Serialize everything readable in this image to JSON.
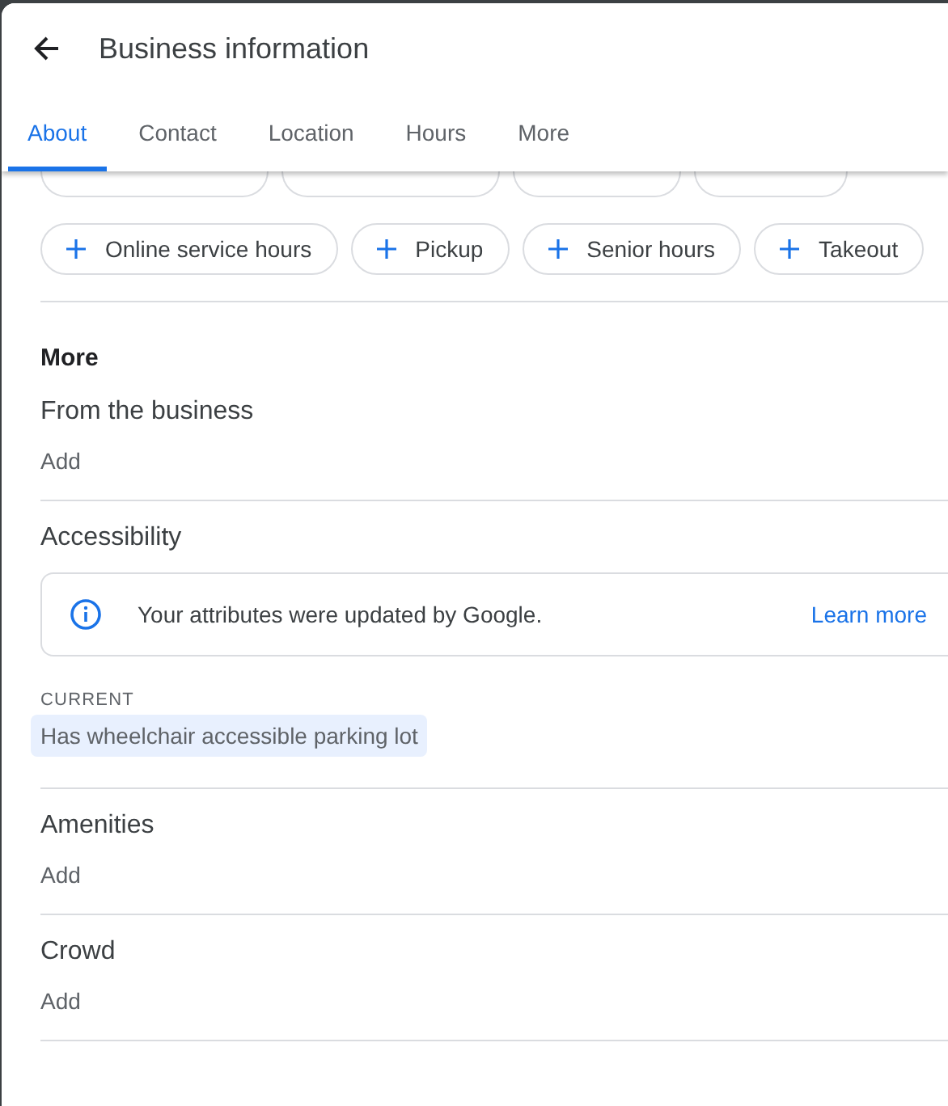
{
  "header": {
    "title": "Business information"
  },
  "tabs": [
    {
      "label": "About",
      "selected": true
    },
    {
      "label": "Contact",
      "selected": false
    },
    {
      "label": "Location",
      "selected": false
    },
    {
      "label": "Hours",
      "selected": false
    },
    {
      "label": "More",
      "selected": false
    }
  ],
  "clipped_chips": [
    {
      "kind": "chip"
    },
    {
      "kind": "chip"
    },
    {
      "kind": "chip"
    },
    {
      "kind": "chip"
    }
  ],
  "chip_rows": [
    [
      "Online service hours",
      "Pickup",
      "Senior hours",
      "Takeout"
    ]
  ],
  "more_section": {
    "title": "More"
  },
  "sections": [
    {
      "kind": "add",
      "title": "From the business",
      "action": "Add"
    },
    {
      "kind": "attributes",
      "title": "Accessibility",
      "notice": {
        "text": "Your attributes were updated by Google.",
        "link": "Learn more"
      },
      "current_label": "CURRENT",
      "current": [
        "Has wheelchair accessible parking lot"
      ]
    },
    {
      "kind": "add",
      "title": "Amenities",
      "action": "Add"
    },
    {
      "kind": "add",
      "title": "Crowd",
      "action": "Add"
    }
  ]
}
